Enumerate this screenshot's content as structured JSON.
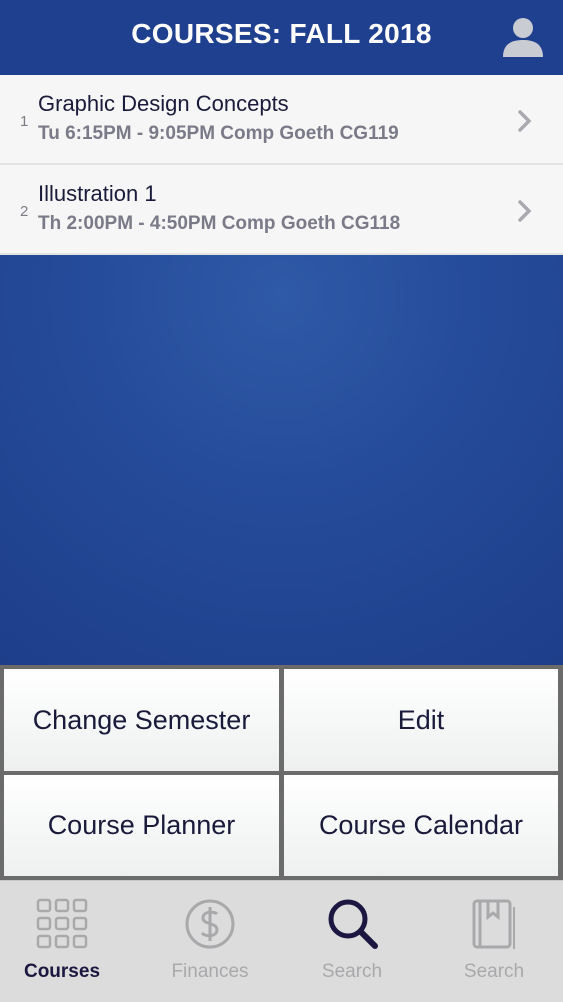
{
  "header": {
    "title": "COURSES: FALL 2018",
    "profile_icon": "user-icon"
  },
  "courses": [
    {
      "index": "1",
      "title": "Graphic Design Concepts",
      "schedule": "Tu 6:15PM - 9:05PM Comp Goeth CG119"
    },
    {
      "index": "2",
      "title": "Illustration 1",
      "schedule": "Th 2:00PM - 4:50PM Comp Goeth CG118"
    }
  ],
  "actions": {
    "change_semester": "Change Semester",
    "edit": "Edit",
    "course_planner": "Course Planner",
    "course_calendar": "Course Calendar"
  },
  "tabs": [
    {
      "label": "Courses",
      "icon": "grid-icon",
      "active": true
    },
    {
      "label": "Finances",
      "icon": "dollar-icon",
      "active": false
    },
    {
      "label": "Search",
      "icon": "search-icon",
      "active": false
    },
    {
      "label": "Search",
      "icon": "book-icon",
      "active": false
    }
  ],
  "colors": {
    "brand": "#1f3f8f",
    "active_tab": "#1b1740",
    "inactive_tab": "#a9a9ac"
  }
}
